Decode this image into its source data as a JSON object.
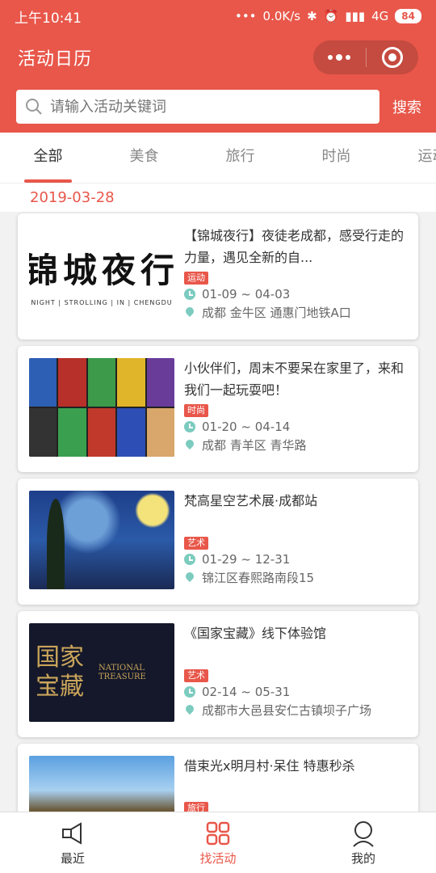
{
  "status_bar": {
    "time": "上午10:41",
    "dots": "•••",
    "speed": "0.0K/s",
    "network": "4G",
    "battery": "84"
  },
  "header": {
    "title": "活动日历"
  },
  "search": {
    "placeholder": "请输入活动关键词",
    "button": "搜索"
  },
  "tabs": [
    {
      "label": "全部",
      "active": true
    },
    {
      "label": "美食",
      "active": false
    },
    {
      "label": "旅行",
      "active": false
    },
    {
      "label": "时尚",
      "active": false
    },
    {
      "label": "运动",
      "active": false
    }
  ],
  "date": "2019-03-28",
  "events": [
    {
      "title": "【锦城夜行】夜徒老成都，感受行走的力量，遇见全新的自...",
      "tag": "运动",
      "dates": "01-09 ~ 04-03",
      "location": "成都 金牛区 通惠门地铁A口",
      "image_text": "锦城夜行",
      "image_sub": "NIGHT | STROLLING | IN | CHENGDU"
    },
    {
      "title": "小伙伴们，周末不要呆在家里了，来和我们一起玩耍吧！",
      "tag": "时尚",
      "dates": "01-20 ~ 04-14",
      "location": "成都 青羊区 青华路"
    },
    {
      "title": "梵高星空艺术展·成都站",
      "tag": "艺术",
      "dates": "01-29 ~ 12-31",
      "location": "锦江区春熙路南段15"
    },
    {
      "title": "《国家宝藏》线下体验馆",
      "tag": "艺术",
      "dates": "02-14 ~ 05-31",
      "location": "成都市大邑县安仁古镇坝子广场",
      "image_text": "国家宝藏",
      "image_sub": "NATIONAL TREASURE"
    },
    {
      "title": "借束光x明月村·呆住 特惠秒杀",
      "tag": "旅行",
      "dates": "",
      "location": ""
    }
  ],
  "bottom_nav": [
    {
      "label": "最近",
      "icon": "megaphone-icon",
      "active": false
    },
    {
      "label": "找活动",
      "icon": "grid-icon",
      "active": true
    },
    {
      "label": "我的",
      "icon": "user-icon",
      "active": false
    }
  ],
  "colors": {
    "primary": "#e8574a",
    "accent_teal": "#7ccbbf"
  }
}
